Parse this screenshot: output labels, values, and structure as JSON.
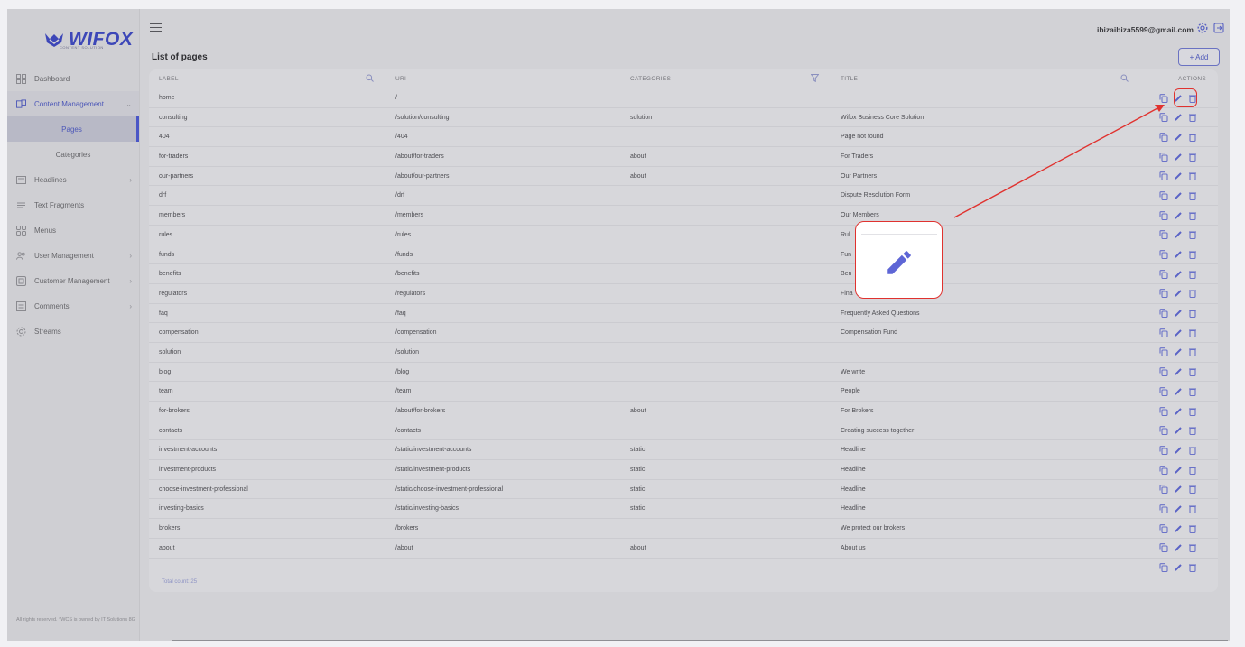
{
  "brand": {
    "name": "WIFOX",
    "tagline": "CONTENT SOLUTION"
  },
  "sidebar": {
    "items": [
      {
        "label": "Dashboard",
        "icon": "dashboard-icon"
      },
      {
        "label": "Content Management",
        "icon": "content-icon",
        "expanded": true
      },
      {
        "label": "Headlines",
        "icon": "headlines-icon",
        "chevron": true
      },
      {
        "label": "Text Fragments",
        "icon": "text-icon"
      },
      {
        "label": "Menus",
        "icon": "menus-icon"
      },
      {
        "label": "User Management",
        "icon": "users-icon",
        "chevron": true
      },
      {
        "label": "Customer Management",
        "icon": "customer-icon",
        "chevron": true
      },
      {
        "label": "Comments",
        "icon": "comments-icon",
        "chevron": true
      },
      {
        "label": "Streams",
        "icon": "gear-icon"
      }
    ],
    "submenu": [
      {
        "label": "Pages",
        "active": true
      },
      {
        "label": "Categories",
        "active": false
      }
    ],
    "footer": "All rights reserved. *WCS is owned by IT Solutions 8G"
  },
  "header": {
    "user_email": "ibizaibiza5599@gmail.com"
  },
  "page": {
    "title": "List of pages",
    "add_label": "+ Add"
  },
  "table": {
    "columns": {
      "label": "LABEL",
      "uri": "URI",
      "categories": "CATEGORIES",
      "title": "TITLE",
      "actions": "ACTIONS"
    },
    "rows": [
      {
        "label": "home",
        "uri": "/",
        "category": "",
        "title": ""
      },
      {
        "label": "consulting",
        "uri": "/solution/consulting",
        "category": "solution",
        "title": "Wifox Business Core Solution"
      },
      {
        "label": "404",
        "uri": "/404",
        "category": "",
        "title": "Page not found"
      },
      {
        "label": "for-traders",
        "uri": "/about/for-traders",
        "category": "about",
        "title": "For Traders"
      },
      {
        "label": "our-partners",
        "uri": "/about/our-partners",
        "category": "about",
        "title": "Our Partners"
      },
      {
        "label": "drf",
        "uri": "/drf",
        "category": "",
        "title": "Dispute Resolution Form"
      },
      {
        "label": "members",
        "uri": "/members",
        "category": "",
        "title": "Our Members"
      },
      {
        "label": "rules",
        "uri": "/rules",
        "category": "",
        "title": "Rul"
      },
      {
        "label": "funds",
        "uri": "/funds",
        "category": "",
        "title": "Fun"
      },
      {
        "label": "benefits",
        "uri": "/benefits",
        "category": "",
        "title": "Ben"
      },
      {
        "label": "regulators",
        "uri": "/regulators",
        "category": "",
        "title": "Fina"
      },
      {
        "label": "faq",
        "uri": "/faq",
        "category": "",
        "title": "Frequently Asked Questions"
      },
      {
        "label": "compensation",
        "uri": "/compensation",
        "category": "",
        "title": "Compensation Fund"
      },
      {
        "label": "solution",
        "uri": "/solution",
        "category": "",
        "title": ""
      },
      {
        "label": "blog",
        "uri": "/blog",
        "category": "",
        "title": "We write"
      },
      {
        "label": "team",
        "uri": "/team",
        "category": "",
        "title": "People"
      },
      {
        "label": "for-brokers",
        "uri": "/about/for-brokers",
        "category": "about",
        "title": "For Brokers"
      },
      {
        "label": "contacts",
        "uri": "/contacts",
        "category": "",
        "title": "Creating success together"
      },
      {
        "label": "investment-accounts",
        "uri": "/static/investment-accounts",
        "category": "static",
        "title": "Headline"
      },
      {
        "label": "investment-products",
        "uri": "/static/investment-products",
        "category": "static",
        "title": "Headline"
      },
      {
        "label": "choose-investment-professional",
        "uri": "/static/choose-investment-professional",
        "category": "static",
        "title": "Headline"
      },
      {
        "label": "investing-basics",
        "uri": "/static/investing-basics",
        "category": "static",
        "title": "Headline"
      },
      {
        "label": "brokers",
        "uri": "/brokers",
        "category": "",
        "title": "We protect our brokers"
      },
      {
        "label": "about",
        "uri": "/about",
        "category": "about",
        "title": "About us"
      },
      {
        "label": "",
        "uri": "",
        "category": "",
        "title": ""
      }
    ],
    "total": "Total count: 25"
  },
  "annotation": {
    "highlight_color": "#e0322f",
    "icon": "pencil-icon"
  },
  "colors": {
    "accent": "#4a56c6",
    "highlight": "#e0322f"
  }
}
